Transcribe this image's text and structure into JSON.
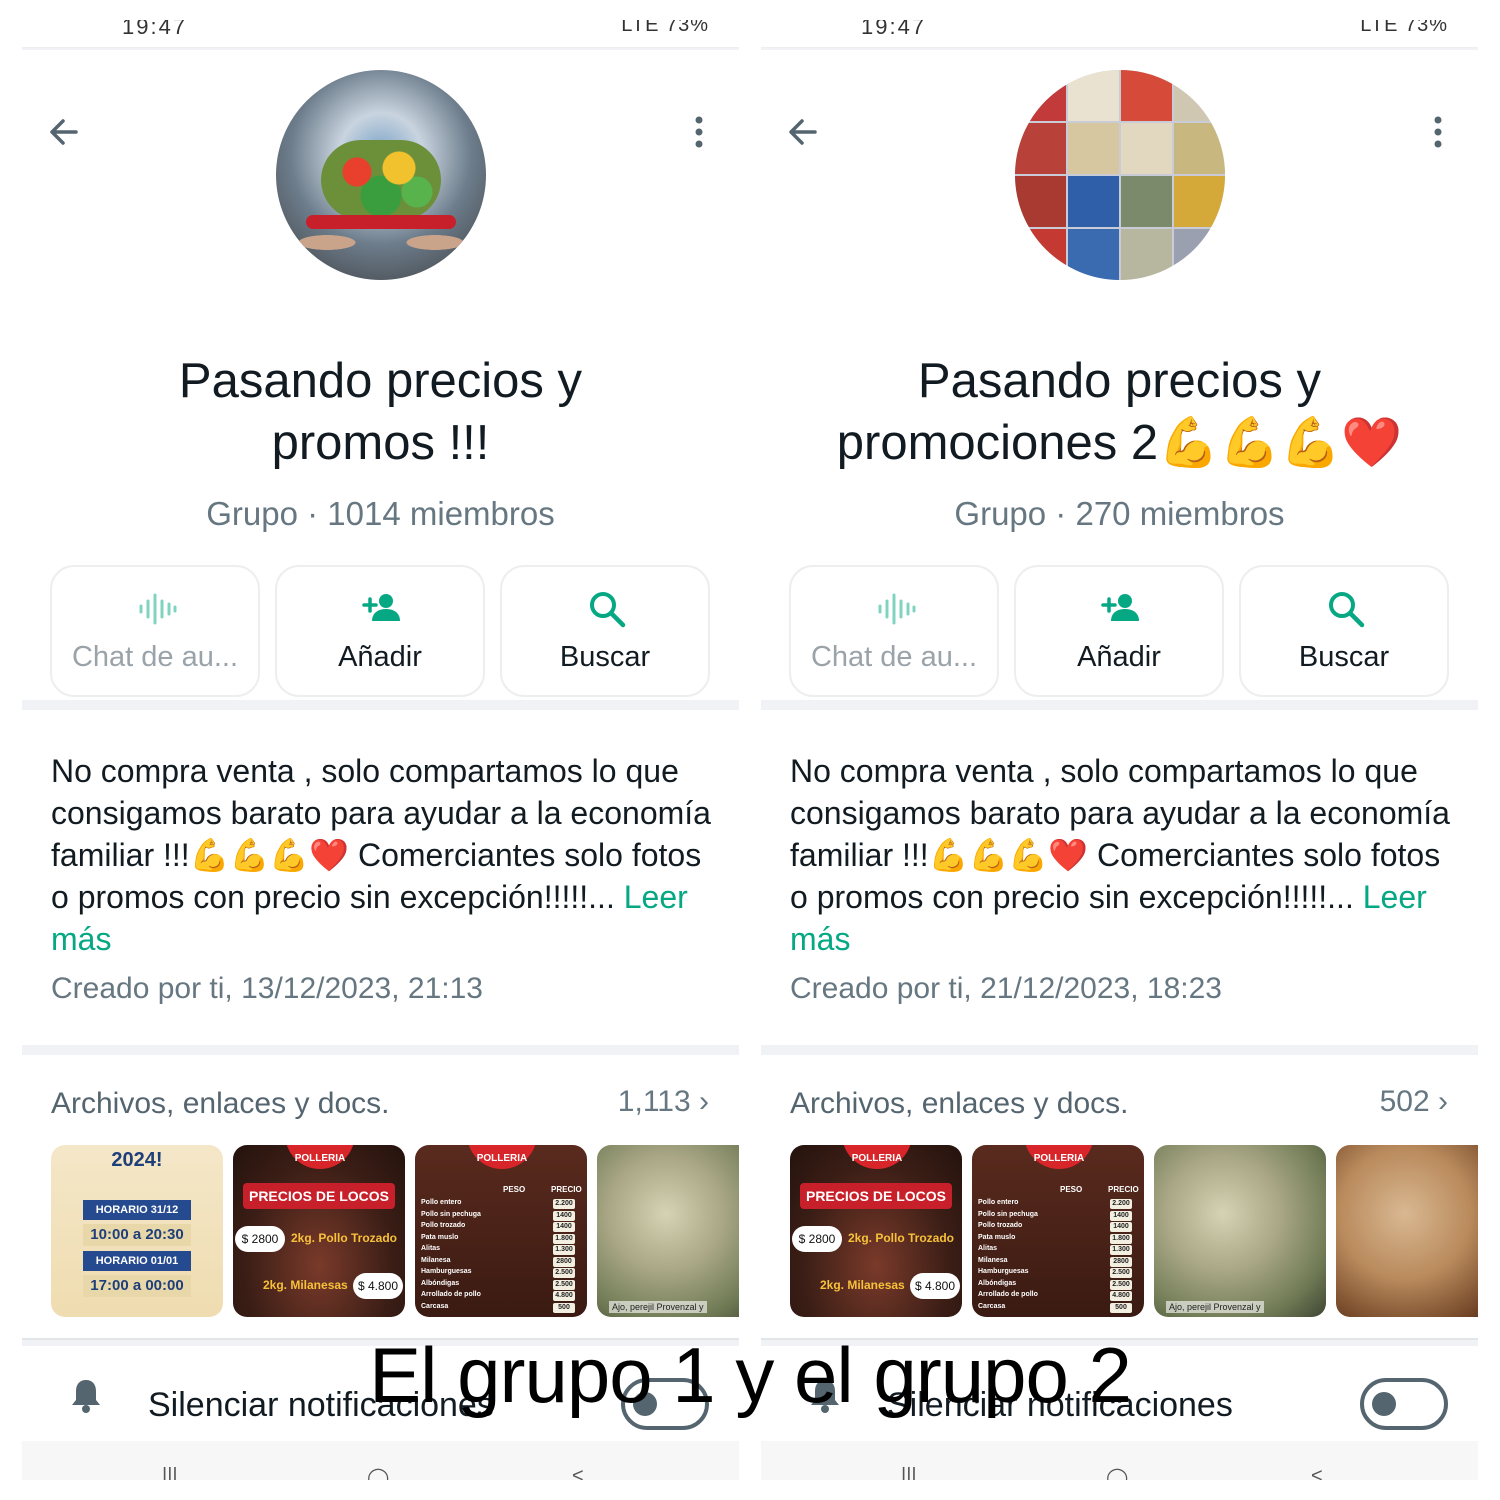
{
  "overlay_caption": "El grupo 1 y el grupo 2",
  "status_bar": {
    "time": "19:47",
    "right": "LTE 73%"
  },
  "actions": {
    "audio_chat": "Chat de au...",
    "add": "Añadir",
    "search": "Buscar"
  },
  "left": {
    "title_line1": "Pasando precios y",
    "title_line2": "promos !!!",
    "meta": "Grupo · 1014 miembros",
    "description": "No compra venta , solo compartamos lo que consigamos barato para ayudar a la economía familiar !!!💪💪💪❤️ Comerciantes solo fotos o promos con precio sin excepción!!!!!...",
    "read_more": "Leer más",
    "created": "Creado por ti, 13/12/2023, 21:13",
    "media_title": "Archivos, enlaces y docs.",
    "media_count": "1,113",
    "mute_label": "Silenciar notificaciones"
  },
  "right": {
    "title_line1": "Pasando precios y",
    "title_line2": "promociones 2💪💪💪❤️",
    "meta": "Grupo · 270 miembros",
    "description": "No compra venta , solo compartamos lo que consigamos barato para ayudar a la economía familiar !!!💪💪💪❤️ Comerciantes solo fotos o promos con precio sin excepción!!!!!...",
    "read_more": "Leer más",
    "created": "Creado por ti, 21/12/2023, 18:23",
    "media_title": "Archivos, enlaces y docs.",
    "media_count": "502",
    "mute_label": "Silenciar notificaciones"
  },
  "thumbs": {
    "schedule": {
      "year": "2024!",
      "bar1": "HORARIO 31/12",
      "time1": "10:00 a 20:30",
      "bar2": "HORARIO 01/01",
      "time2": "17:00 a 00:00"
    },
    "promo": {
      "logo": "POLLERIA",
      "title": "PRECIOS DE LOCOS",
      "price1": "$ 2800",
      "item1": "2kg. Pollo Trozado",
      "item2": "2kg. Milanesas",
      "price2": "$ 4.800"
    },
    "table": {
      "logo": "POLLERIA",
      "col_weight": "PESO",
      "col_price": "PRECIO",
      "rows": [
        {
          "name": "Pollo entero",
          "price": "2.200"
        },
        {
          "name": "Pollo sin pechuga",
          "price": "1400"
        },
        {
          "name": "Pollo trozado",
          "price": "1400"
        },
        {
          "name": "Pata muslo",
          "price": "1.800"
        },
        {
          "name": "Alitas",
          "price": "1.300"
        },
        {
          "name": "Milanesa",
          "price": "2800"
        },
        {
          "name": "Hamburguesas",
          "price": "2.500"
        },
        {
          "name": "Albóndigas",
          "price": "2.500"
        },
        {
          "name": "Arrollado de pollo",
          "price": "4.800"
        },
        {
          "name": "Carcasa",
          "price": "500"
        }
      ]
    },
    "chicken_caption": "Ajo, perejil Provenzal y"
  },
  "nav": {
    "recent": "|||",
    "home": "◯",
    "back": "<"
  },
  "colors": {
    "accent": "#06a884",
    "text": "#111b21",
    "muted": "#667781",
    "background": "#f0f2f5"
  }
}
